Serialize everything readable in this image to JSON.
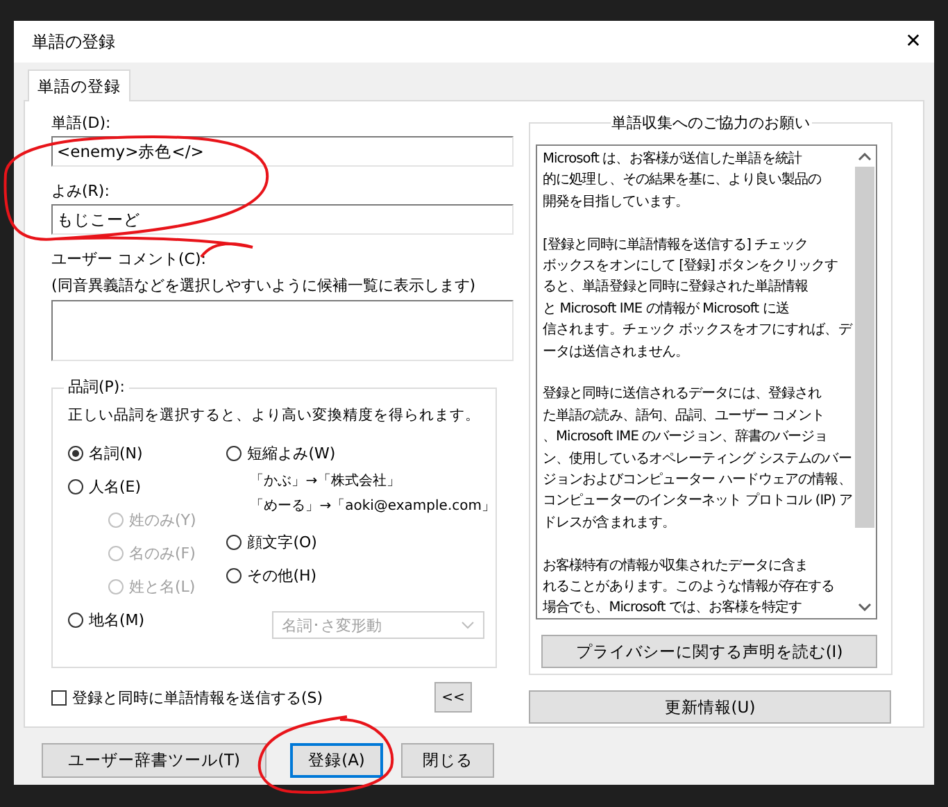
{
  "window": {
    "title": "単語の登録",
    "close": "✕"
  },
  "tabs": [
    {
      "label": "単語の登録",
      "selected": true
    }
  ],
  "word": {
    "label": "単語(D):",
    "value": "<enemy>赤色</>"
  },
  "reading": {
    "label": "よみ(R):",
    "value": "もじこーど"
  },
  "comment": {
    "label": "ユーザー コメント(C):",
    "hint": "(同音異義語などを選択しやすいように候補一覧に表示します)"
  },
  "part_of_speech": {
    "label": "品詞(P):",
    "hint": "正しい品詞を選択すると、より高い変換精度を得られます。",
    "left_options": [
      {
        "label": "名詞(N)",
        "selected": true
      },
      {
        "label": "人名(E)",
        "selected": false,
        "children": [
          {
            "label": "姓のみ(Y)",
            "selected": false,
            "disabled": true
          },
          {
            "label": "名のみ(F)",
            "selected": false,
            "disabled": true
          },
          {
            "label": "姓と名(L)",
            "selected": false,
            "disabled": true
          }
        ]
      },
      {
        "label": "地名(M)",
        "selected": false
      }
    ],
    "right_options": [
      {
        "label": "短縮よみ(W)",
        "selected": false,
        "examples": [
          "「かぶ」→「株式会社」",
          "「めーる」→「aoki@example.com」"
        ]
      },
      {
        "label": "顔文字(O)",
        "selected": false
      },
      {
        "label": "その他(H)",
        "selected": false
      }
    ],
    "dropdown": {
      "value": "名詞･さ変形動",
      "disabled": true
    }
  },
  "send_checkbox": {
    "label": "登録と同時に単語情報を送信する(S)",
    "checked": false
  },
  "collapse_button": "<<",
  "info_group": {
    "title": "単語収集へのご協力のお願い",
    "paragraphs": [
      [
        "Microsoft は、お客様が送信した単語を統計",
        "的に処理し、その結果を基に、より良い製品の",
        "開発を目指しています。"
      ],
      [
        "[登録と同時に単語情報を送信する] チェック",
        "ボックスをオンにして [登録] ボタンをクリックす",
        "ると、単語登録と同時に登録された単語情報",
        "と Microsoft IME の情報が Microsoft に送",
        "信されます。チェック ボックスをオフにすれば、デ",
        "ータは送信されません。"
      ],
      [
        "登録と同時に送信されるデータには、登録され",
        "た単語の読み、語句、品詞、ユーザー コメント",
        "、Microsoft IME のバージョン、辞書のバージョ",
        "ン、使用しているオペレーティング システムのバー",
        "ジョンおよびコンピューター ハードウェアの情報、",
        "コンピューターのインターネット プロトコル (IP) ア",
        "ドレスが含まれます。"
      ],
      [
        "お客様特有の情報が収集されたデータに含ま",
        "れることがあります。このような情報が存在する",
        "場合でも、Microsoft では、お客様を特定す"
      ]
    ],
    "privacy_button": "プライバシーに関する声明を読む(I)"
  },
  "update_button": "更新情報(U)",
  "buttons": [
    {
      "label": "ユーザー辞書ツール(T)",
      "focused": false
    },
    {
      "label": "登録(A)",
      "focused": true
    },
    {
      "label": "閉じる",
      "focused": false
    }
  ]
}
